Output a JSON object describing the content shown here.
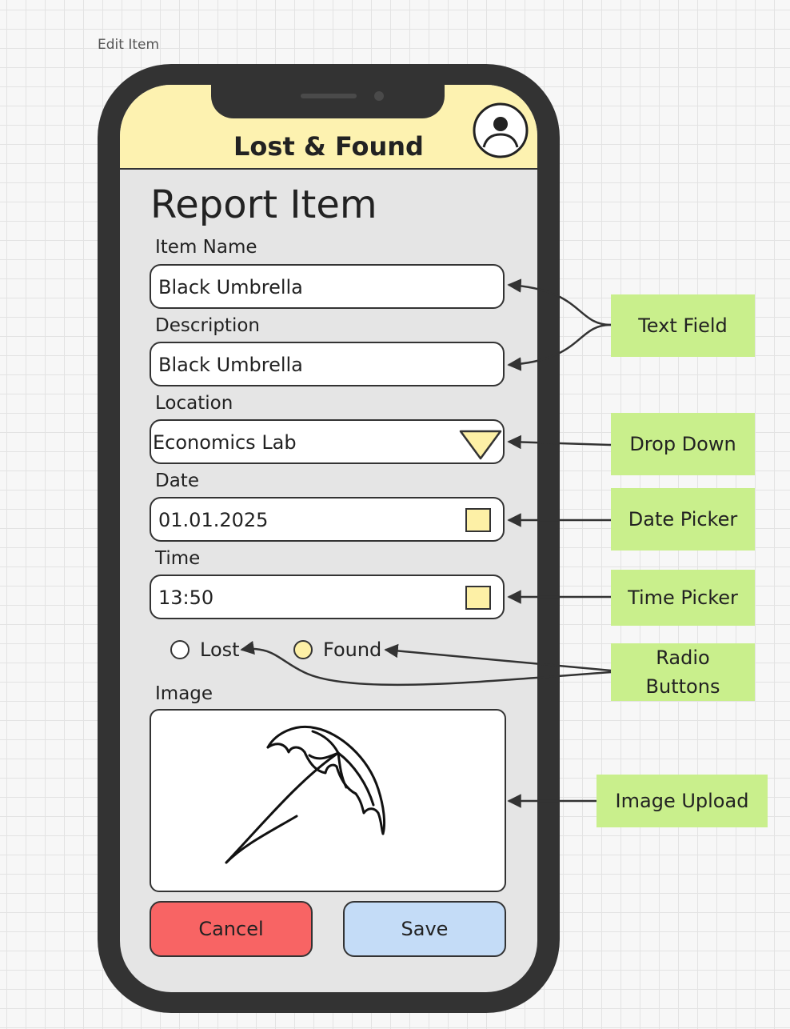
{
  "frame": {
    "title": "Edit Item"
  },
  "app": {
    "title": "Lost & Found"
  },
  "page": {
    "title": "Report Item"
  },
  "form": {
    "item_name": {
      "label": "Item Name",
      "value": "Black Umbrella"
    },
    "description": {
      "label": "Description",
      "value": "Black Umbrella"
    },
    "location": {
      "label": "Location",
      "value": "Economics Lab"
    },
    "date": {
      "label": "Date",
      "value": "01.01.2025"
    },
    "time": {
      "label": "Time",
      "value": "13:50"
    },
    "status": {
      "options": [
        {
          "label": "Lost",
          "selected": false
        },
        {
          "label": "Found",
          "selected": true
        }
      ]
    },
    "image": {
      "label": "Image"
    }
  },
  "buttons": {
    "cancel": "Cancel",
    "save": "Save"
  },
  "annotations": {
    "text_field": "Text Field",
    "drop_down": "Drop Down",
    "date_picker": "Date Picker",
    "time_picker": "Time Picker",
    "radio_buttons": "Radio Buttons",
    "image_upload": "Image Upload"
  },
  "colors": {
    "header": "#fdf2b0",
    "phone_body": "#333333",
    "screen": "#e5e5e5",
    "cancel": "#f86464",
    "save": "#c4dcf7",
    "annotation": "#c9ef8c",
    "picker_accent": "#fdf0a6"
  }
}
